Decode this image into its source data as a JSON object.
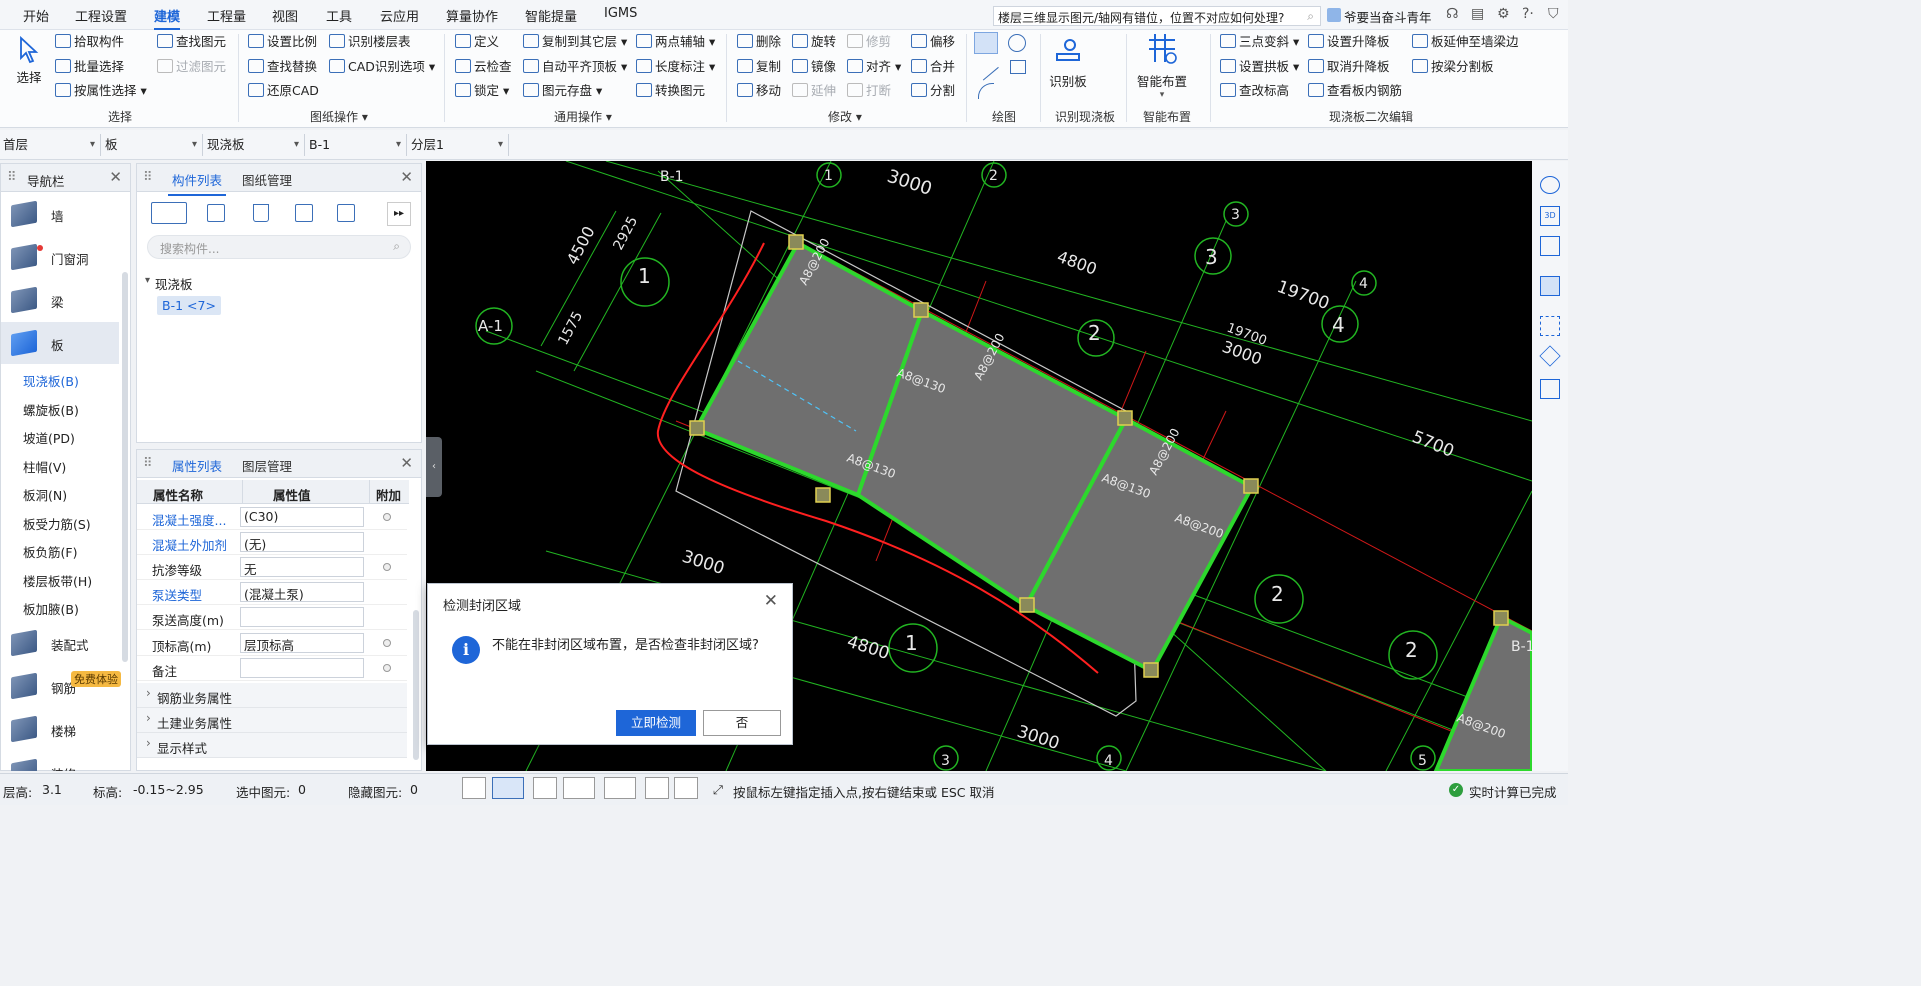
{
  "menu": [
    "开始",
    "工程设置",
    "建模",
    "工程量",
    "视图",
    "工具",
    "云应用",
    "算量协作",
    "智能提量",
    "IGMS"
  ],
  "active_menu": "建模",
  "search": {
    "text": "楼层三维显示图元/轴网有错位，位置不对应如何处理?"
  },
  "user": {
    "name": "爷要当奋斗青年"
  },
  "ribbon": {
    "select_label": "选择",
    "g1": [
      "拾取构件",
      "批量选择",
      "按属性选择"
    ],
    "g1b": [
      "查找图元",
      "过滤图元"
    ],
    "g1_label": "选择",
    "g2": [
      "设置比例",
      "查找替换",
      "还原CAD"
    ],
    "g2b": [
      "识别楼层表",
      "CAD识别选项"
    ],
    "g2_label": "图纸操作",
    "g3": [
      "定义",
      "云检查",
      "锁定"
    ],
    "g3b": [
      "复制到其它层",
      "自动平齐顶板",
      "图元存盘"
    ],
    "g3c": [
      "两点辅轴",
      "长度标注",
      "转换图元"
    ],
    "g3_label": "通用操作",
    "g4": [
      "删除",
      "复制",
      "移动"
    ],
    "g4b": [
      "旋转",
      "镜像",
      "延伸"
    ],
    "g4c": [
      "修剪",
      "对齐",
      "打断"
    ],
    "g4d": [
      "偏移",
      "合并",
      "分割"
    ],
    "g4_label": "修改",
    "g5_label": "绘图",
    "g6": "识别板",
    "g6_label": "识别现浇板",
    "g7": "智能布置",
    "g7_label": "智能布置",
    "g8": [
      "三点变斜",
      "设置拱板",
      "查改标高"
    ],
    "g8b": [
      "设置升降板",
      "取消升降板",
      "查看板内钢筋"
    ],
    "g8c": [
      "板延伸至墙梁边",
      "按梁分割板"
    ],
    "g8_label": "现浇板二次编辑"
  },
  "dropdowns": [
    "首层",
    "板",
    "现浇板",
    "B-1",
    "分层1"
  ],
  "nav": {
    "title": "导航栏",
    "items": [
      "墙",
      "门窗洞",
      "梁",
      "板",
      "装配式",
      "钢筋",
      "楼梯",
      "装修"
    ],
    "sub": [
      "现浇板(B)",
      "螺旋板(B)",
      "坡道(PD)",
      "柱帽(V)",
      "板洞(N)",
      "板受力筋(S)",
      "板负筋(F)",
      "楼层板带(H)",
      "板加腋(B)"
    ],
    "badge": "免费体验"
  },
  "component_panel": {
    "tabs": [
      "构件列表",
      "图纸管理"
    ],
    "search_placeholder": "搜索构件...",
    "tree_root": "现浇板",
    "tree_item": "B-1 <7>"
  },
  "prop_panel": {
    "tabs": [
      "属性列表",
      "图层管理"
    ],
    "headers": [
      "属性名称",
      "属性值",
      "附加"
    ],
    "rows": [
      {
        "name": "混凝土强度...",
        "value": "(C30)"
      },
      {
        "name": "混凝土外加剂",
        "value": "(无)"
      },
      {
        "name": "抗渗等级",
        "value": "无"
      },
      {
        "name": "泵送类型",
        "value": "(混凝土泵)"
      },
      {
        "name": "泵送高度(m)",
        "value": ""
      },
      {
        "name": "顶标高(m)",
        "value": "层顶标高"
      },
      {
        "name": "备注",
        "value": ""
      }
    ],
    "sections": [
      "钢筋业务属性",
      "土建业务属性",
      "显示样式"
    ]
  },
  "cad": {
    "axis_labels": [
      "B-1",
      "1",
      "2",
      "3",
      "3",
      "4",
      "4",
      "A-1",
      "1",
      "2",
      "2",
      "2",
      "2",
      "1",
      "5",
      "3",
      "4",
      "5",
      "B-1"
    ],
    "dims": [
      "3000",
      "4500",
      "2925",
      "1575",
      "4800",
      "19700",
      "19700",
      "3000",
      "5700",
      "3000",
      "4800",
      "3000"
    ],
    "rebar": [
      "A8@200",
      "A8@130",
      "A8@200",
      "A8@130",
      "A8@130",
      "A8@200",
      "A8@200",
      "A8@200"
    ]
  },
  "dialog": {
    "title": "检测封闭区域",
    "message": "不能在非封闭区域布置，是否检查非封闭区域?",
    "ok": "立即检测",
    "no": "否"
  },
  "status": {
    "floor_h": "层高:",
    "floor_h_val": "3.1",
    "elev": "标高:",
    "elev_val": "-0.15~2.95",
    "selected": "选中图元:",
    "selected_val": "0",
    "hidden": "隐藏图元:",
    "hidden_val": "0",
    "hint": "按鼠标左键指定插入点,按右键结束或 ESC 取消",
    "calc": "实时计算已完成"
  }
}
